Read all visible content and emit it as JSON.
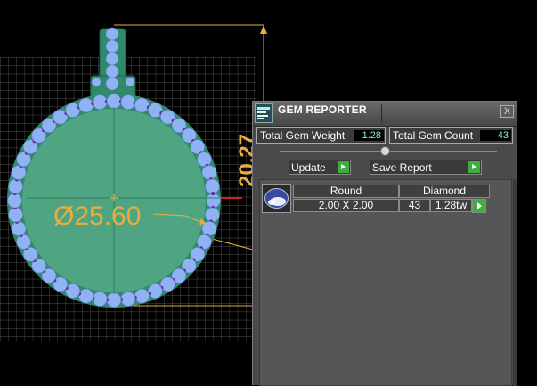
{
  "viewport": {
    "diameter_label": "Ø25.60",
    "height_label": "20.27"
  },
  "panel": {
    "title": "GEM REPORTER",
    "close_label": "X",
    "total_weight_label": "Total Gem Weight",
    "total_weight_value": "1.28",
    "total_count_label": "Total Gem Count",
    "total_count_value": "43",
    "update_label": "Update",
    "save_label": "Save Report"
  },
  "gem_table": {
    "shape": "Round",
    "material": "Diamond",
    "size": "2.00 X 2.00",
    "count": "43",
    "weight": "1.28tw"
  },
  "colors": {
    "background": "#000000",
    "pendant_fill": "#4fa582",
    "gem": "#8fb2f2",
    "dimension": "#e8ad3c",
    "value_text": "#7ff2e0",
    "play_button": "#3fae3f"
  }
}
